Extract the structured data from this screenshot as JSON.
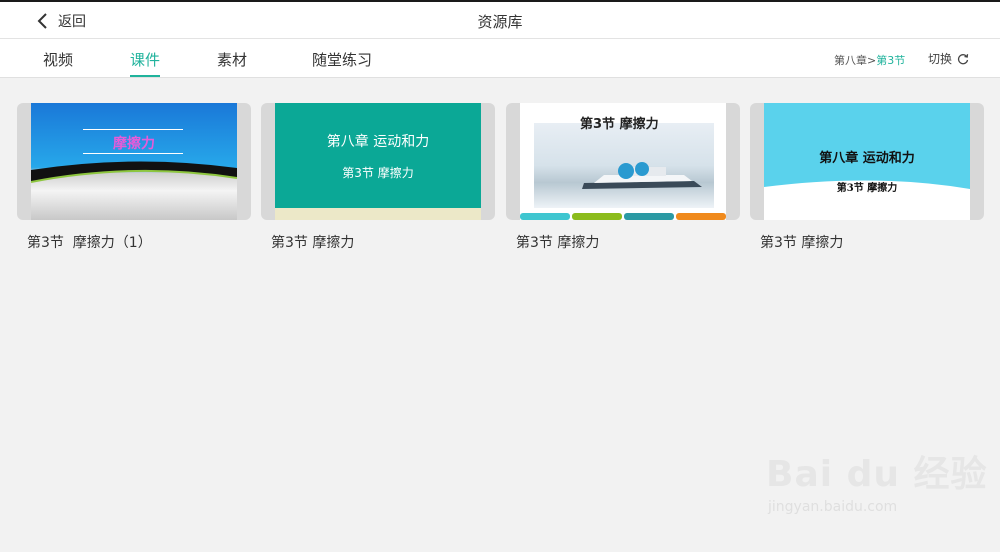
{
  "header": {
    "back_label": "返回",
    "title": "资源库"
  },
  "tabs": [
    {
      "label": "视频",
      "active": false
    },
    {
      "label": "课件",
      "active": true
    },
    {
      "label": "素材",
      "active": false
    },
    {
      "label": "随堂练习",
      "active": false
    }
  ],
  "chapter": {
    "path_prefix": "第八章>",
    "path_current": "第3节",
    "switch_label": "切换"
  },
  "cards": [
    {
      "label": "第3节  摩擦力（1）",
      "slide_text": "摩擦力"
    },
    {
      "label": "第3节 摩擦力",
      "slide_title": "第八章 运动和力",
      "slide_subtitle": "第3节    摩擦力"
    },
    {
      "label": "第3节 摩擦力",
      "slide_title": "第3节   摩擦力"
    },
    {
      "label": "第3节 摩擦力",
      "slide_title": "第八章 运动和力",
      "slide_subtitle": "第3节 摩擦力"
    }
  ],
  "watermark": {
    "main": "Bai du 经验",
    "sub": "jingyan.baidu.com"
  },
  "colors": {
    "accent": "#20b39c",
    "background": "#f2f2f2"
  }
}
